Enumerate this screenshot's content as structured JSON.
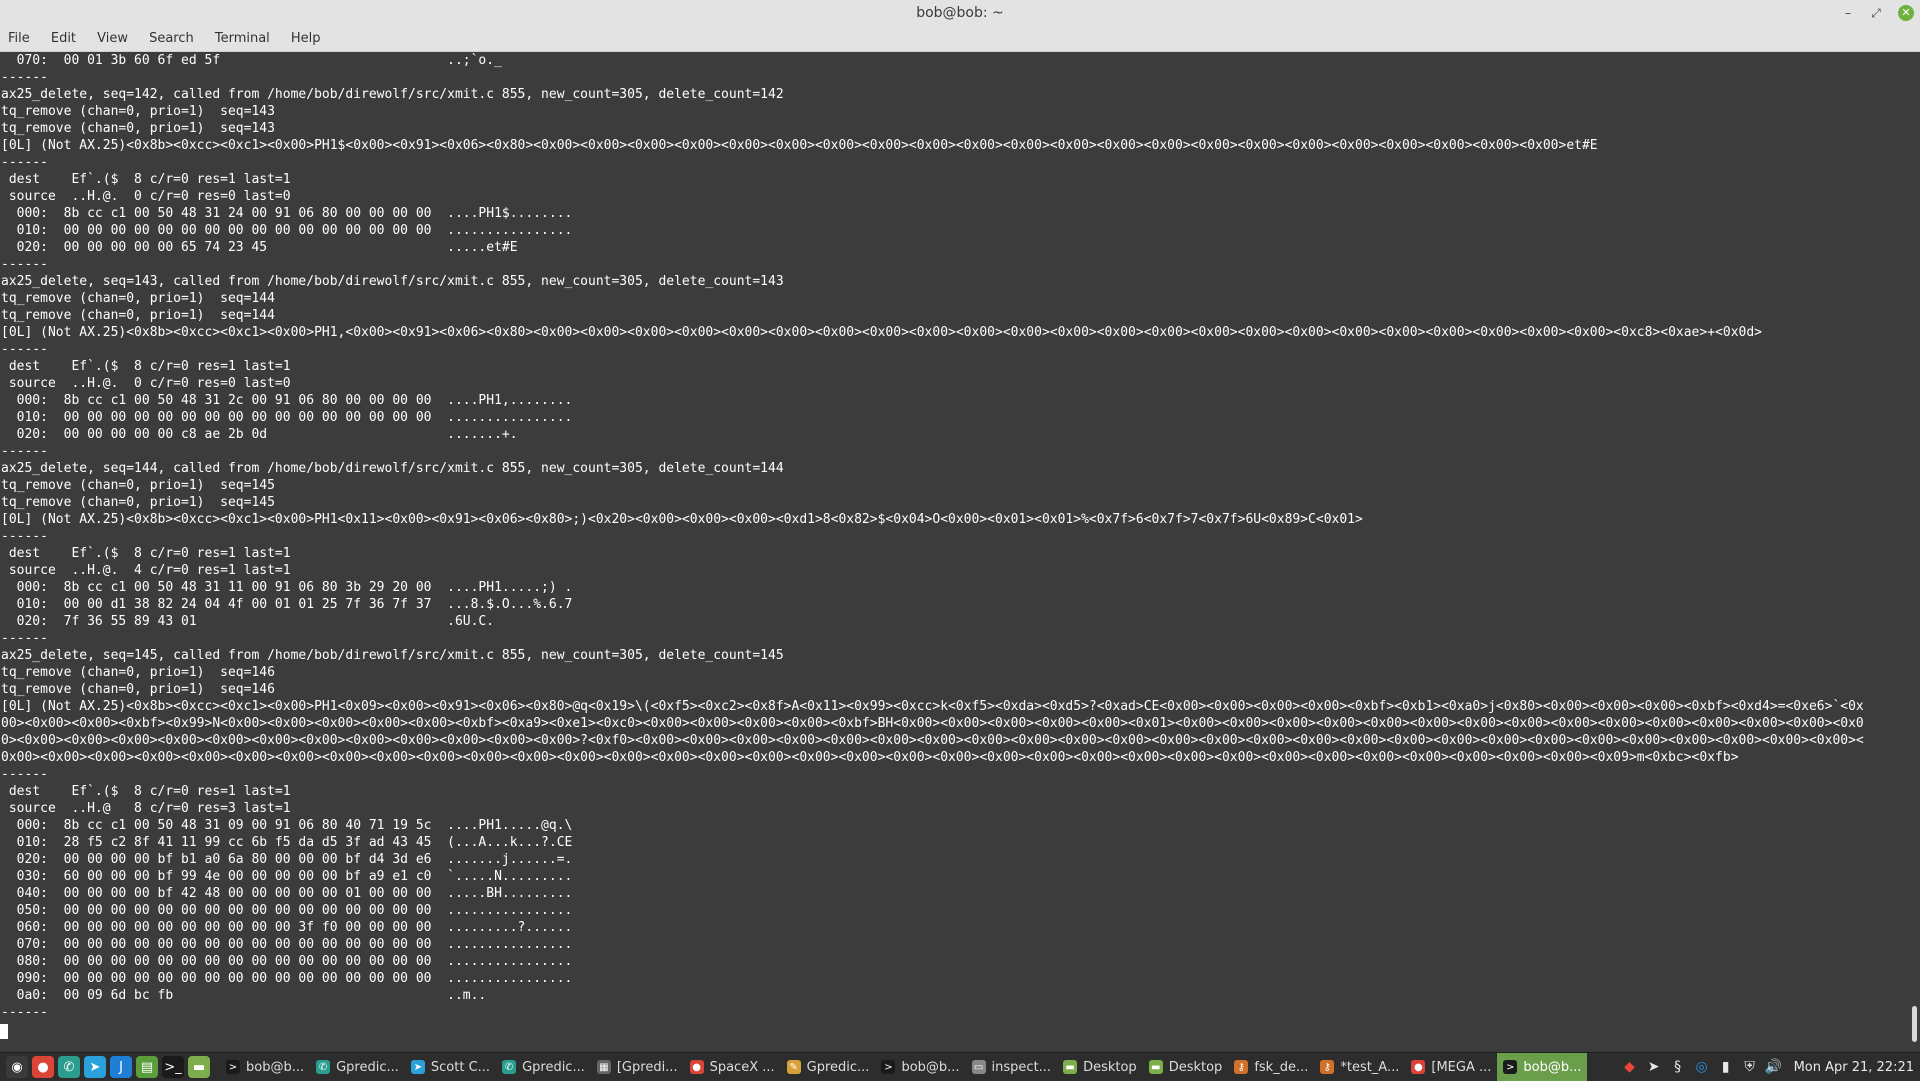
{
  "window": {
    "title": "bob@bob: ~",
    "minimize_glyph": "–",
    "maximize_glyph": "⤢",
    "close_glyph": "✕"
  },
  "menu": [
    "File",
    "Edit",
    "View",
    "Search",
    "Terminal",
    "Help"
  ],
  "terminal": {
    "lines": [
      "  070:  00 01 3b 60 6f ed 5f                             ..;`o._",
      "------",
      "ax25_delete, seq=142, called from /home/bob/direwolf/src/xmit.c 855, new_count=305, delete_count=142",
      "tq_remove (chan=0, prio=1)  seq=143",
      "tq_remove (chan=0, prio=1)  seq=143",
      "[0L] (Not AX.25)<0x8b><0xcc><0xc1><0x00>PH1$<0x00><0x91><0x06><0x80><0x00><0x00><0x00><0x00><0x00><0x00><0x00><0x00><0x00><0x00><0x00><0x00><0x00><0x00><0x00><0x00><0x00><0x00><0x00><0x00><0x00><0x00>et#E",
      "------",
      " dest    Ef`.($  8 c/r=0 res=1 last=1",
      " source  ..H.@.  0 c/r=0 res=0 last=0",
      "  000:  8b cc c1 00 50 48 31 24 00 91 06 80 00 00 00 00  ....PH1$........",
      "  010:  00 00 00 00 00 00 00 00 00 00 00 00 00 00 00 00  ................",
      "  020:  00 00 00 00 00 65 74 23 45                       .....et#E",
      "------",
      "ax25_delete, seq=143, called from /home/bob/direwolf/src/xmit.c 855, new_count=305, delete_count=143",
      "tq_remove (chan=0, prio=1)  seq=144",
      "tq_remove (chan=0, prio=1)  seq=144",
      "[0L] (Not AX.25)<0x8b><0xcc><0xc1><0x00>PH1,<0x00><0x91><0x06><0x80><0x00><0x00><0x00><0x00><0x00><0x00><0x00><0x00><0x00><0x00><0x00><0x00><0x00><0x00><0x00><0x00><0x00><0x00><0x00><0x00><0x00><0x00><0x00><0xc8><0xae>+<0x0d>",
      "------",
      " dest    Ef`.($  8 c/r=0 res=1 last=1",
      " source  ..H.@.  0 c/r=0 res=0 last=0",
      "  000:  8b cc c1 00 50 48 31 2c 00 91 06 80 00 00 00 00  ....PH1,........",
      "  010:  00 00 00 00 00 00 00 00 00 00 00 00 00 00 00 00  ................",
      "  020:  00 00 00 00 00 c8 ae 2b 0d                       .......+.",
      "------",
      "ax25_delete, seq=144, called from /home/bob/direwolf/src/xmit.c 855, new_count=305, delete_count=144",
      "tq_remove (chan=0, prio=1)  seq=145",
      "tq_remove (chan=0, prio=1)  seq=145",
      "[0L] (Not AX.25)<0x8b><0xcc><0xc1><0x00>PH1<0x11><0x00><0x91><0x06><0x80>;)<0x20><0x00><0x00><0x00><0xd1>8<0x82>$<0x04>O<0x00><0x01><0x01>%<0x7f>6<0x7f>7<0x7f>6U<0x89>C<0x01>",
      "------",
      " dest    Ef`.($  8 c/r=0 res=1 last=1",
      " source  ..H.@.  4 c/r=0 res=1 last=1",
      "  000:  8b cc c1 00 50 48 31 11 00 91 06 80 3b 29 20 00  ....PH1.....;) .",
      "  010:  00 00 d1 38 82 24 04 4f 00 01 01 25 7f 36 7f 37  ...8.$.O...%.6.7",
      "  020:  7f 36 55 89 43 01                                .6U.C.",
      "------",
      "ax25_delete, seq=145, called from /home/bob/direwolf/src/xmit.c 855, new_count=305, delete_count=145",
      "tq_remove (chan=0, prio=1)  seq=146",
      "tq_remove (chan=0, prio=1)  seq=146",
      "[0L] (Not AX.25)<0x8b><0xcc><0xc1><0x00>PH1<0x09><0x00><0x91><0x06><0x80>@q<0x19>\\(<0xf5><0xc2><0x8f>A<0x11><0x99><0xcc>k<0xf5><0xda><0xd5>?<0xad>CE<0x00><0x00><0x00><0x00><0xbf><0xb1><0xa0>j<0x80><0x00><0x00><0x00><0xbf><0xd4>=<0xe6>`<0x",
      "00><0x00><0x00><0xbf><0x99>N<0x00><0x00><0x00><0x00><0x00><0xbf><0xa9><0xe1><0xc0><0x00><0x00><0x00><0x00><0xbf>BH<0x00><0x00><0x00><0x00><0x00><0x01><0x00><0x00><0x00><0x00><0x00><0x00><0x00><0x00><0x00><0x00><0x00><0x00><0x00><0x00><0x0",
      "0><0x00><0x00><0x00><0x00><0x00><0x00><0x00><0x00><0x00><0x00><0x00><0x00>?<0xf0><0x00><0x00><0x00><0x00><0x00><0x00><0x00><0x00><0x00><0x00><0x00><0x00><0x00><0x00><0x00><0x00><0x00><0x00><0x00><0x00><0x00><0x00><0x00><0x00><0x00><0x00><",
      "0x00><0x00><0x00><0x00><0x00><0x00><0x00><0x00><0x00><0x00><0x00><0x00><0x00><0x00><0x00><0x00><0x00><0x00><0x00><0x00><0x00><0x00><0x00><0x00><0x00><0x00><0x00><0x00><0x00><0x00><0x00><0x00><0x00><0x00><0x09>m<0xbc><0xfb>",
      "------",
      " dest    Ef`.($  8 c/r=0 res=1 last=1",
      " source  ..H.@   8 c/r=0 res=3 last=1",
      "  000:  8b cc c1 00 50 48 31 09 00 91 06 80 40 71 19 5c  ....PH1.....@q.\\",
      "  010:  28 f5 c2 8f 41 11 99 cc 6b f5 da d5 3f ad 43 45  (...A...k...?.CE",
      "  020:  00 00 00 00 bf b1 a0 6a 80 00 00 00 bf d4 3d e6  .......j......=.",
      "  030:  60 00 00 00 bf 99 4e 00 00 00 00 00 bf a9 e1 c0  `.....N.........",
      "  040:  00 00 00 00 bf 42 48 00 00 00 00 00 01 00 00 00  .....BH.........",
      "  050:  00 00 00 00 00 00 00 00 00 00 00 00 00 00 00 00  ................",
      "  060:  00 00 00 00 00 00 00 00 00 00 3f f0 00 00 00 00  .........?......",
      "  070:  00 00 00 00 00 00 00 00 00 00 00 00 00 00 00 00  ................",
      "  080:  00 00 00 00 00 00 00 00 00 00 00 00 00 00 00 00  ................",
      "  090:  00 00 00 00 00 00 00 00 00 00 00 00 00 00 00 00  ................",
      "  0a0:  00 09 6d bc fb                                   ..m..",
      "------"
    ]
  },
  "taskbar": {
    "launchers": [
      {
        "name": "menu-icon",
        "glyph": "◉",
        "color": "#3a3a3a"
      },
      {
        "name": "chrome-icon",
        "glyph": "●",
        "color": "#db4437"
      },
      {
        "name": "gpredict-icon",
        "glyph": "✆",
        "color": "#2a9d8f"
      },
      {
        "name": "telegram-icon",
        "glyph": "➤",
        "color": "#2aa1da"
      },
      {
        "name": "joplin-icon",
        "glyph": "J",
        "color": "#1f7fd6"
      },
      {
        "name": "files-green-icon",
        "glyph": "▤",
        "color": "#5a9e3c"
      },
      {
        "name": "terminal-icon",
        "glyph": ">_",
        "color": "#1a1a1a"
      },
      {
        "name": "folder-icon",
        "glyph": "▬",
        "color": "#7cae4c"
      }
    ],
    "tasks": [
      {
        "name": "task-terminal-1",
        "label": "bob@b...",
        "glyph": ">",
        "color": "#1a1a1a",
        "active": false
      },
      {
        "name": "task-gpredict-1",
        "label": "Gpredic...",
        "glyph": "✆",
        "color": "#2a9d8f",
        "active": false
      },
      {
        "name": "task-telegram",
        "label": "Scott C...",
        "glyph": "➤",
        "color": "#2aa1da",
        "active": false
      },
      {
        "name": "task-gpredict-2",
        "label": "Gpredic...",
        "glyph": "✆",
        "color": "#2a9d8f",
        "active": false
      },
      {
        "name": "task-gpredict-3",
        "label": "[Gpredi...",
        "glyph": "▦",
        "color": "#666666",
        "active": false
      },
      {
        "name": "task-chrome-spacex",
        "label": "SpaceX ...",
        "glyph": "●",
        "color": "#db4437",
        "active": false
      },
      {
        "name": "task-gpredict-4",
        "label": "Gpredic...",
        "glyph": "✎",
        "color": "#d8a03a",
        "active": false
      },
      {
        "name": "task-terminal-2",
        "label": "bob@b...",
        "glyph": ">",
        "color": "#1a1a1a",
        "active": false
      },
      {
        "name": "task-inspect",
        "label": "inspect...",
        "glyph": "▭",
        "color": "#888888",
        "active": false
      },
      {
        "name": "task-desktop-1",
        "label": "Desktop",
        "glyph": "▬",
        "color": "#7cae4c",
        "active": false
      },
      {
        "name": "task-desktop-2",
        "label": "Desktop",
        "glyph": "▬",
        "color": "#7cae4c",
        "active": false
      },
      {
        "name": "task-fsk",
        "label": "fsk_de...",
        "glyph": "⚷",
        "color": "#d2722a",
        "active": false
      },
      {
        "name": "task-test",
        "label": "*test_A...",
        "glyph": "⚷",
        "color": "#d2722a",
        "active": false
      },
      {
        "name": "task-mega",
        "label": "[MEGA ...",
        "glyph": "●",
        "color": "#db4437",
        "active": false
      },
      {
        "name": "task-terminal-active",
        "label": "bob@b...",
        "glyph": ">",
        "color": "#1a1a1a",
        "active": true
      }
    ],
    "tray": [
      {
        "name": "anydesk-icon",
        "glyph": "◆",
        "color": "#e8453c"
      },
      {
        "name": "telegram-tray-icon",
        "glyph": "➤",
        "color": "#e8e8e8"
      },
      {
        "name": "sync-icon",
        "glyph": "§",
        "color": "#e8e8e8"
      },
      {
        "name": "blue-app-icon",
        "glyph": "◎",
        "color": "#2a8fe0"
      },
      {
        "name": "network-icon",
        "glyph": "▮",
        "color": "#e8e8e8"
      },
      {
        "name": "shield-icon",
        "glyph": "⛨",
        "color": "#e8e8e8"
      },
      {
        "name": "volume-icon",
        "glyph": "🔊",
        "color": "#e8e8e8"
      }
    ],
    "clock": "Mon Apr 21, 22:21"
  }
}
